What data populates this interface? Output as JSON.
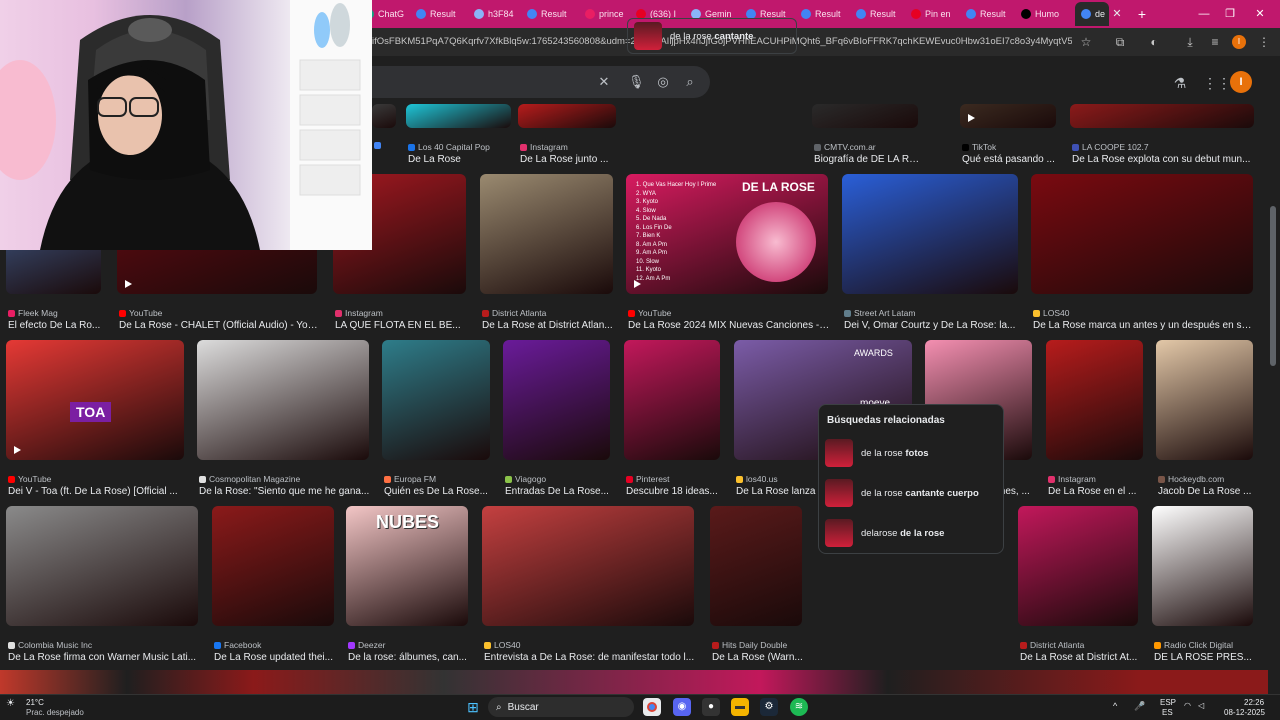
{
  "browser": {
    "tabs": [
      {
        "label": "ChatG",
        "color": "#10a37f"
      },
      {
        "label": "Result",
        "color": "#4285f4"
      },
      {
        "label": "h3F84",
        "color": "#8ab4f8"
      },
      {
        "label": "Result",
        "color": "#4285f4"
      },
      {
        "label": "prince",
        "color": "#e91e63"
      },
      {
        "label": "(636) I",
        "color": "#e60023"
      },
      {
        "label": "Gemin",
        "color": "#8ab4f8"
      },
      {
        "label": "Result",
        "color": "#4285f4"
      },
      {
        "label": "Result",
        "color": "#4285f4"
      },
      {
        "label": "Result",
        "color": "#4285f4"
      },
      {
        "label": "Pin en",
        "color": "#e60023"
      },
      {
        "label": "Result",
        "color": "#4285f4"
      },
      {
        "label": "Humo",
        "color": "#000000"
      },
      {
        "label": "de",
        "color": "#4285f4"
      }
    ],
    "url": "ifOsFBKM51PqA7Q6Kqrfv7XfkBlq5w:1765243560808&udm=2&fbs=AIljpHx4nJjfGojPVHhEACUHPiMQht6_BFq6vBIoFFRK7qchKEWEvuc0Hbw31oEI7c8o3y4MyqtV5m4rL...",
    "new_tab": "+",
    "close_tab": "✕",
    "profile_initial": "I"
  },
  "search": {
    "clear": "✕",
    "avatar_initial": "I"
  },
  "related": {
    "heading": "Búsquedas relacionadas",
    "items": [
      {
        "prefix": "de la rose",
        "bold": "fotos"
      },
      {
        "prefix": "de la rose",
        "bold": "cantante cuerpo"
      },
      {
        "prefix": "delarose",
        "bold": "de la rose"
      }
    ],
    "top_suggestion": {
      "prefix": "de la rose",
      "bold": "cantante"
    }
  },
  "rows": [
    [
      {
        "source": "",
        "title": "",
        "fav": "#4285f4"
      },
      {
        "source": "Los 40 Capital Pop",
        "title": "De La Rose",
        "fav": "#1a73e8"
      },
      {
        "source": "Instagram",
        "title": "De La Rose junto ...",
        "fav": "#e1306c"
      },
      {
        "source": "CMTV.com.ar",
        "title": "Biografía de DE LA ROSE",
        "fav": "#5f6368"
      },
      {
        "source": "TikTok",
        "title": "Qué está pasando ...",
        "fav": "#000000"
      },
      {
        "source": "LA COOPE 102.7",
        "title": "De La Rose explota con su debut mun...",
        "fav": "#3f51b5"
      }
    ],
    [
      {
        "source": "Fleek Mag",
        "title": "El efecto De La Ro...",
        "fav": "#e91e63"
      },
      {
        "source": "YouTube",
        "title": "De La Rose - CHALET (Official Audio) - You...",
        "fav": "#ff0000"
      },
      {
        "source": "Instagram",
        "title": "LA QUE FLOTA EN EL BE...",
        "fav": "#e1306c"
      },
      {
        "source": "District Atlanta",
        "title": "De La Rose at District Atlan...",
        "fav": "#b71c1c"
      },
      {
        "source": "YouTube",
        "title": "De La Rose 2024 MIX Nuevas Canciones - ...",
        "fav": "#ff0000"
      },
      {
        "source": "Street Art Latam",
        "title": "Dei V, Omar Courtz y De La Rose: la...",
        "fav": "#607d8b"
      },
      {
        "source": "LOS40",
        "title": "De La Rose marca un antes y un después en su...",
        "fav": "#fbc02d"
      }
    ],
    [
      {
        "source": "YouTube",
        "title": "Dei V - Toa (ft. De La Rose) [Official ...",
        "fav": "#ff0000"
      },
      {
        "source": "Cosmopolitan Magazine",
        "title": "De la Rose: \"Siento que me he gana...",
        "fav": "#e0e0e0"
      },
      {
        "source": "Europa FM",
        "title": "Quién es De La Rose...",
        "fav": "#ff7043"
      },
      {
        "source": "Viagogo",
        "title": "Entradas De La Rose...",
        "fav": "#8bc34a"
      },
      {
        "source": "Pinterest",
        "title": "Descubre 18 ideas...",
        "fav": "#e60023"
      },
      {
        "source": "los40.us",
        "title": "De La Rose lanza su primer álbum 'F...",
        "fav": "#fbc02d"
      },
      {
        "source": "Deezer",
        "title": "De la rose: álbumes, ...",
        "fav": "#a238ff"
      },
      {
        "source": "Instagram",
        "title": "De La Rose en el ...",
        "fav": "#e1306c"
      },
      {
        "source": "Hockeydb.com",
        "title": "Jacob De La Rose ...",
        "fav": "#795548"
      }
    ],
    [
      {
        "source": "Colombia Music Inc",
        "title": "De La Rose firma con Warner Music Lati...",
        "fav": "#e0e0e0"
      },
      {
        "source": "Facebook",
        "title": "De La Rose updated thei...",
        "fav": "#1877f2"
      },
      {
        "source": "Deezer",
        "title": "De la rose: álbumes, can...",
        "fav": "#a238ff"
      },
      {
        "source": "LOS40",
        "title": "Entrevista a De La Rose: de manifestar todo l...",
        "fav": "#fbc02d"
      },
      {
        "source": "Hits Daily Double",
        "title": "De La Rose (Warn...",
        "fav": "#b71c1c"
      },
      {
        "source": "District Atlanta",
        "title": "De La Rose at District At...",
        "fav": "#b71c1c"
      },
      {
        "source": "Radio Click Digital",
        "title": "DE LA ROSE PRES...",
        "fav": "#ff9800"
      }
    ]
  ],
  "thumbs_text": {
    "tracklist_title": "DE LA ROSE",
    "tracklist": [
      "1. Que Vas Hacer Hoy I Prime",
      "2. WYA",
      "3. Kyoto",
      "4. Slow",
      "5. De Nada",
      "6. Los Fin De",
      "7. Bien K",
      "8. Am A Pm",
      "9. Am A Pm",
      "10. Slow",
      "11. Kyoto",
      "12. Am A Pm"
    ],
    "toa": "TOA",
    "nubes": "NUBES",
    "awards": "AWARDS",
    "moeve": "moeve"
  },
  "taskbar": {
    "temp": "21°C",
    "weather": "Prac. despejado",
    "search_label": "Buscar",
    "lang_top": "ESP",
    "lang_bottom": "ES",
    "time": "22:26",
    "date": "08-12-2025"
  },
  "colors": {
    "tabbar": "#c0186d",
    "background": "#1f1f1f",
    "accent": "#e8710a"
  }
}
